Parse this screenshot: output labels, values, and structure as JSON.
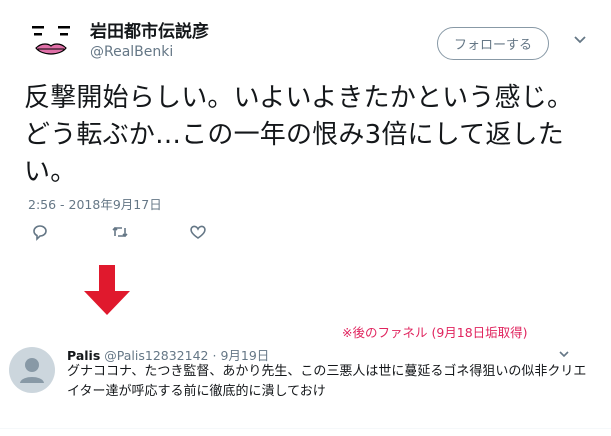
{
  "tweet": {
    "display_name": "岩田都市伝説彦",
    "handle": "@RealBenki",
    "follow_label": "フォローする",
    "text": "反撃開始らしい。いよいよきたかという感じ。どう転ぶか…この一年の恨み3倍にして返したい。",
    "timestamp": "2:56 - 2018年9月17日",
    "actions": [
      "reply-icon",
      "retweet-icon",
      "like-icon"
    ]
  },
  "annotation": {
    "note": "※後のファネル (9月18日垢取得)",
    "arrow_color": "#e0192d"
  },
  "reply": {
    "name": "Palis",
    "handle": "@Palis12832142",
    "separator": "·",
    "date": "9月19日",
    "text": "グナココナ、たつき監督、あかり先生、この三悪人は世に蔓延るゴネ得狙いの似非クリエイター達が呼応する前に徹底的に潰しておけ"
  },
  "colors": {
    "text": "#14171a",
    "secondary": "#657786",
    "note": "#e0245e",
    "avatar_bg": "#ccd6dd"
  }
}
